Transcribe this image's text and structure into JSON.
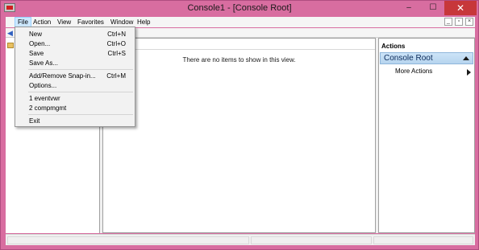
{
  "window": {
    "title": "Console1 - [Console Root]",
    "controls": {
      "minimize": "–",
      "maximize": "☐",
      "close": "✕"
    },
    "colors": {
      "frame": "#d86da0",
      "close": "#c7373a"
    }
  },
  "menubar": {
    "items": [
      "File",
      "Action",
      "View",
      "Favorites",
      "Window",
      "Help"
    ],
    "active": "File",
    "mdi_controls": {
      "minimize": "_",
      "restore": "▫",
      "close": "×"
    }
  },
  "file_menu": {
    "items": [
      {
        "label": "New",
        "shortcut": "Ctrl+N"
      },
      {
        "label": "Open...",
        "shortcut": "Ctrl+O"
      },
      {
        "label": "Save",
        "shortcut": "Ctrl+S"
      },
      {
        "label": "Save As...",
        "shortcut": ""
      },
      {
        "label": "Add/Remove Snap-in...",
        "shortcut": "Ctrl+M"
      },
      {
        "label": "Options...",
        "shortcut": ""
      },
      {
        "label": "1 eventvwr",
        "shortcut": ""
      },
      {
        "label": "2 compmgmt",
        "shortcut": ""
      },
      {
        "label": "Exit",
        "shortcut": ""
      }
    ]
  },
  "center": {
    "empty_message": "There are no items to show in this view."
  },
  "actions_pane": {
    "title": "Actions",
    "section": "Console Root",
    "items": [
      {
        "label": "More Actions"
      }
    ]
  },
  "icons": {
    "app": "mmc-console-icon",
    "back": "back-arrow-icon",
    "tree_node": "folder-icon"
  }
}
